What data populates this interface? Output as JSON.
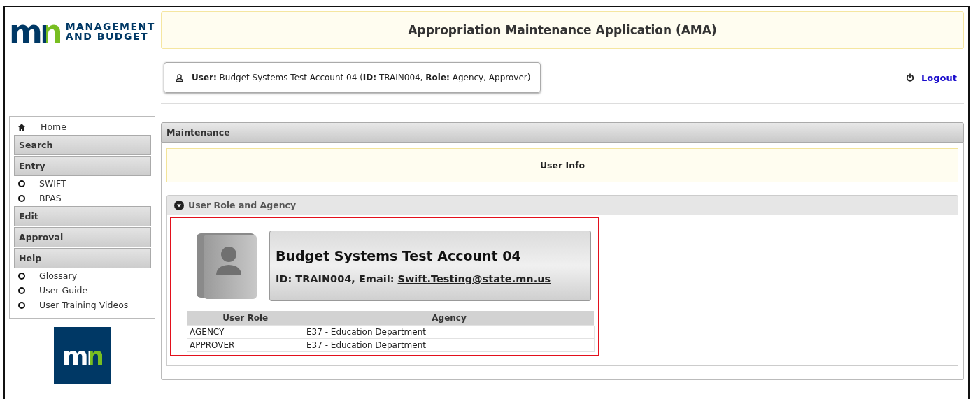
{
  "logo": {
    "mark": "mn",
    "line_1": "MANAGEMENT",
    "line_2": "AND BUDGET"
  },
  "header": {
    "title": "Appropriation Maintenance Application (AMA)"
  },
  "user_bar": {
    "text": "**User:** Budget Systems Test Account 04 (**ID:** TRAIN004, **Role:** Agency, Approver)"
  },
  "logout": {
    "label": "Logout"
  },
  "sidebar": {
    "items": [
      {
        "kind": "home",
        "label": "Home"
      },
      {
        "kind": "header",
        "label": "Search"
      },
      {
        "kind": "header",
        "label": "Entry"
      },
      {
        "kind": "subitem",
        "label": "SWIFT"
      },
      {
        "kind": "subitem",
        "label": "BPAS"
      },
      {
        "kind": "header",
        "label": "Edit"
      },
      {
        "kind": "header",
        "label": "Approval"
      },
      {
        "kind": "header",
        "label": "Help"
      },
      {
        "kind": "subitem",
        "label": "Glossary"
      },
      {
        "kind": "subitem",
        "label": "User Guide"
      },
      {
        "kind": "subitem",
        "label": "User Training Videos"
      }
    ],
    "badge": "mn"
  },
  "maintenance": {
    "title": "Maintenance",
    "banner": "User Info",
    "section": {
      "title": "User Role and Agency",
      "expanded": true,
      "profile": {
        "name": "Budget Systems Test Account 04",
        "details": "ID: TRAIN004, Email: ",
        "email": "Swift.Testing@state.mn.us"
      },
      "table": {
        "columns": [
          "User Role",
          "Agency"
        ],
        "rows": [
          [
            "AGENCY",
            "E37 - Education Department"
          ],
          [
            "APPROVER",
            "E37 - Education Department"
          ]
        ]
      }
    }
  }
}
